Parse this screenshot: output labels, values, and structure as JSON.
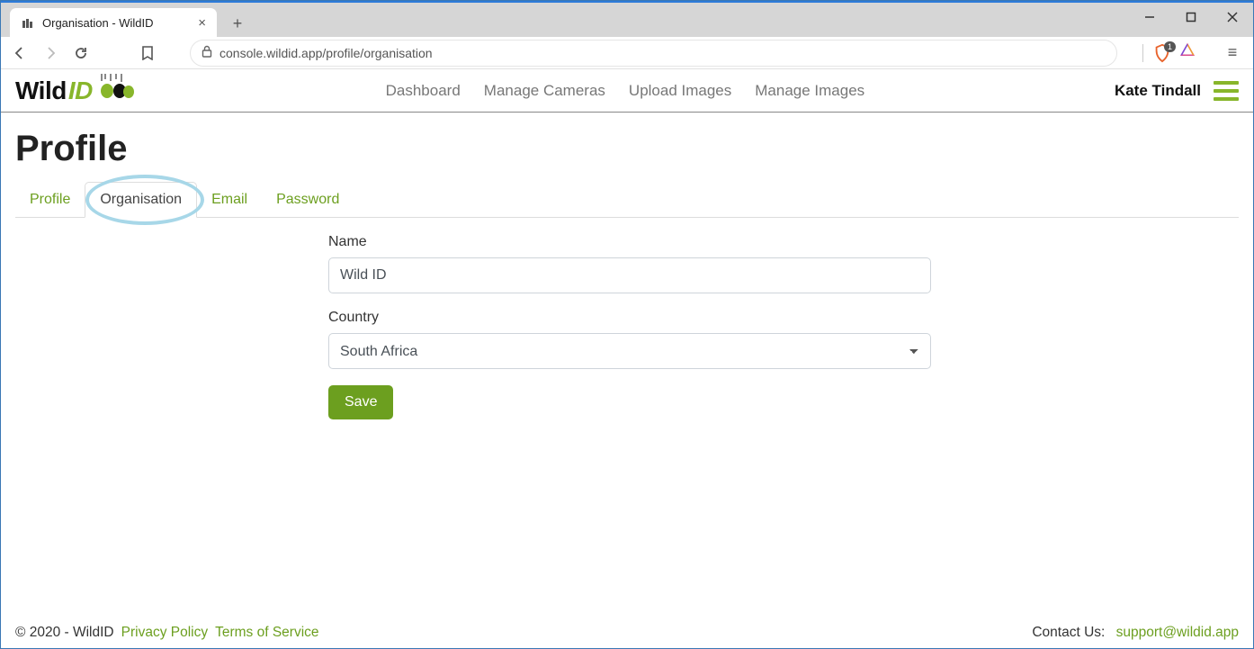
{
  "browser": {
    "tab_title": "Organisation - WildID",
    "url": "console.wildid.app/profile/organisation",
    "shield_count": "1"
  },
  "header": {
    "logo_text_a": "Wild",
    "logo_text_b": "ID",
    "nav": {
      "dashboard": "Dashboard",
      "cameras": "Manage Cameras",
      "upload": "Upload Images",
      "manage_images": "Manage Images"
    },
    "user_name": "Kate Tindall"
  },
  "page": {
    "title": "Profile",
    "tabs": {
      "profile": "Profile",
      "organisation": "Organisation",
      "email": "Email",
      "password": "Password"
    }
  },
  "form": {
    "name_label": "Name",
    "name_value": "Wild ID",
    "country_label": "Country",
    "country_value": "South Africa",
    "save_label": "Save"
  },
  "footer": {
    "copyright": "© 2020 - WildID",
    "privacy": "Privacy Policy",
    "terms": "Terms of Service",
    "contact_label": "Contact Us: ",
    "contact_email": "support@wildid.app"
  }
}
